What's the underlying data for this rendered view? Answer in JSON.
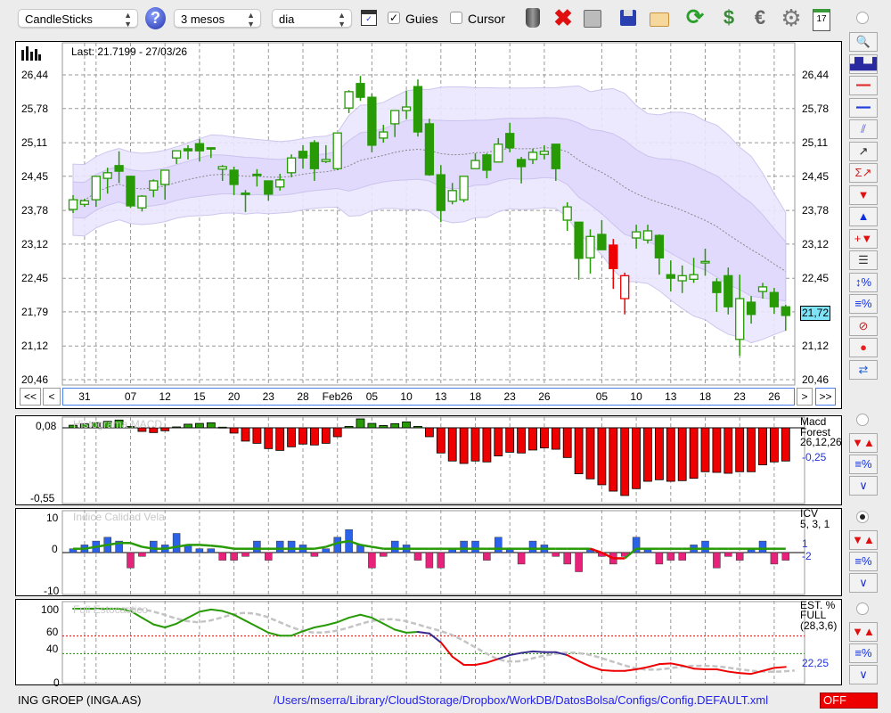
{
  "toolbar": {
    "chart_type": "CandleSticks",
    "period": "3 mesos",
    "interval": "dia",
    "guides_label": "Guies",
    "guides_checked": true,
    "cursor_label": "Cursor",
    "cursor_checked": false,
    "icons": [
      "help-icon",
      "chart-window-icon",
      "trash-icon",
      "delete-icon",
      "print-icon",
      "save-icon",
      "folder-icon",
      "refresh-icon",
      "money-icon",
      "euro-icon",
      "gear-icon",
      "calendar-icon"
    ],
    "calendar_day": "17"
  },
  "main_chart": {
    "last_label": "Last: 21.7199 - 27/03/26",
    "last_value": "21,72",
    "price_ticks": [
      "26,44",
      "25,78",
      "25,11",
      "24,45",
      "23,78",
      "23,12",
      "22,45",
      "21,79",
      "21,12",
      "20,46"
    ],
    "price_tick_values": [
      26.44,
      25.78,
      25.11,
      24.45,
      23.78,
      23.12,
      22.45,
      21.79,
      21.12,
      20.46
    ],
    "colors": {
      "candle": "#279a05",
      "candle_alert": "#ee0000",
      "band_outer": "#ebe6fd",
      "band_inner": "#e0d9fc",
      "last_box": "#7fe3f7"
    }
  },
  "navigation": {
    "first": "<<",
    "prev": "<",
    "next": ">",
    "last": ">>",
    "date_labels": [
      {
        "label": "31",
        "index": 1
      },
      {
        "label": "07",
        "index": 5
      },
      {
        "label": "12",
        "index": 8
      },
      {
        "label": "15",
        "index": 11
      },
      {
        "label": "20",
        "index": 14
      },
      {
        "label": "23",
        "index": 17
      },
      {
        "label": "28",
        "index": 20
      },
      {
        "label": "Feb26",
        "index": 23
      },
      {
        "label": "05",
        "index": 26
      },
      {
        "label": "10",
        "index": 29
      },
      {
        "label": "13",
        "index": 32
      },
      {
        "label": "18",
        "index": 35
      },
      {
        "label": "23",
        "index": 38
      },
      {
        "label": "26",
        "index": 41
      },
      {
        "label": "05",
        "index": 46
      },
      {
        "label": "10",
        "index": 49
      },
      {
        "label": "13",
        "index": 52
      },
      {
        "label": "18",
        "index": 55
      },
      {
        "label": "23",
        "index": 58
      },
      {
        "label": "26",
        "index": 61
      }
    ],
    "extra_grid_index": [
      2
    ]
  },
  "chart_data": [
    {
      "type": "candlestick",
      "title": "CandleSticks",
      "ylim": [
        20.46,
        26.44
      ],
      "candles": [
        [
          23.8,
          24.08,
          23.73,
          23.99
        ],
        [
          23.9,
          24.01,
          23.85,
          23.97
        ],
        [
          23.99,
          24.46,
          23.85,
          24.45
        ],
        [
          24.41,
          24.62,
          24.11,
          24.52
        ],
        [
          24.66,
          24.94,
          24.32,
          24.55
        ],
        [
          24.45,
          24.46,
          23.83,
          23.87
        ],
        [
          23.83,
          24.08,
          23.76,
          24.06
        ],
        [
          24.18,
          24.39,
          24.04,
          24.36
        ],
        [
          24.29,
          24.57,
          23.99,
          24.57
        ],
        [
          24.81,
          24.95,
          24.69,
          24.95
        ],
        [
          24.99,
          25.06,
          24.78,
          24.95
        ],
        [
          25.09,
          25.18,
          24.74,
          24.95
        ],
        [
          25.01,
          25.01,
          24.81,
          25.0
        ],
        [
          24.59,
          24.67,
          24.36,
          24.64
        ],
        [
          24.57,
          24.64,
          24.08,
          24.29
        ],
        [
          24.12,
          24.18,
          23.75,
          24.1
        ],
        [
          24.49,
          24.59,
          24.25,
          24.48
        ],
        [
          24.36,
          24.36,
          23.97,
          24.1
        ],
        [
          24.24,
          24.5,
          24.17,
          24.38
        ],
        [
          24.52,
          24.88,
          24.43,
          24.81
        ],
        [
          24.94,
          25.06,
          24.6,
          24.81
        ],
        [
          25.11,
          25.16,
          24.36,
          24.6
        ],
        [
          24.74,
          25.06,
          24.71,
          24.78
        ],
        [
          24.6,
          25.3,
          24.57,
          25.3
        ],
        [
          25.79,
          26.14,
          25.69,
          26.11
        ],
        [
          26.27,
          26.42,
          25.93,
          26.0
        ],
        [
          26.0,
          26.07,
          24.92,
          25.06
        ],
        [
          25.2,
          25.46,
          25.11,
          25.32
        ],
        [
          25.48,
          25.74,
          25.22,
          25.74
        ],
        [
          25.74,
          26.13,
          25.57,
          25.81
        ],
        [
          26.21,
          26.35,
          25.23,
          25.32
        ],
        [
          25.48,
          25.58,
          24.46,
          24.48
        ],
        [
          24.48,
          24.67,
          23.55,
          23.78
        ],
        [
          23.96,
          24.32,
          23.9,
          24.17
        ],
        [
          23.99,
          24.45,
          23.94,
          24.45
        ],
        [
          24.6,
          24.9,
          24.6,
          24.76
        ],
        [
          24.87,
          24.9,
          24.41,
          24.57
        ],
        [
          24.73,
          25.2,
          24.73,
          25.08
        ],
        [
          25.29,
          25.5,
          24.92,
          25.01
        ],
        [
          24.78,
          24.83,
          24.31,
          24.64
        ],
        [
          24.78,
          24.99,
          24.69,
          24.92
        ],
        [
          24.88,
          25.06,
          24.78,
          24.94
        ],
        [
          25.08,
          25.08,
          24.36,
          24.6
        ],
        [
          23.59,
          23.94,
          23.38,
          23.85
        ],
        [
          23.55,
          23.55,
          22.42,
          22.84
        ],
        [
          22.85,
          23.41,
          22.54,
          23.27
        ],
        [
          23.31,
          23.59,
          23.01,
          23.01
        ],
        [
          23.1,
          23.22,
          22.24,
          22.64
        ],
        [
          22.05,
          22.56,
          21.74,
          22.5
        ],
        [
          23.24,
          23.5,
          23.03,
          23.36
        ],
        [
          23.2,
          23.5,
          23.13,
          23.38
        ],
        [
          23.29,
          23.31,
          22.52,
          22.85
        ],
        [
          22.52,
          22.8,
          22.19,
          22.45
        ],
        [
          22.4,
          22.7,
          22.16,
          22.5
        ],
        [
          22.43,
          22.85,
          22.36,
          22.52
        ],
        [
          22.75,
          23.03,
          22.5,
          22.78
        ],
        [
          22.38,
          22.45,
          21.79,
          22.17
        ],
        [
          22.5,
          22.66,
          21.74,
          21.89
        ],
        [
          21.25,
          22.52,
          20.93,
          22.05
        ],
        [
          21.98,
          22.1,
          21.56,
          21.74
        ],
        [
          22.19,
          22.36,
          22.05,
          22.28
        ],
        [
          22.17,
          22.26,
          21.75,
          21.89
        ],
        [
          21.89,
          21.93,
          21.42,
          21.72
        ]
      ],
      "alert_candles": [
        47,
        48
      ]
    },
    {
      "type": "bar",
      "title": "Histograma MACD",
      "name": "Macd",
      "subtitle": "Forest",
      "params": "26,12,26",
      "last_value": "-0,25",
      "ylim_labels": [
        "0,08",
        "-0,55"
      ],
      "ylim": [
        -0.55,
        0.08
      ],
      "colors": {
        "pos": "#279a05",
        "neg": "#ee0000"
      },
      "values": [
        0.02,
        0.03,
        0.04,
        0.05,
        0.06,
        0.01,
        -0.028,
        -0.037,
        -0.023,
        0.007,
        0.028,
        0.034,
        0.039,
        0.005,
        -0.041,
        -0.103,
        -0.12,
        -0.161,
        -0.175,
        -0.147,
        -0.126,
        -0.133,
        -0.12,
        -0.069,
        0.011,
        0.069,
        0.034,
        0.018,
        0.032,
        0.046,
        0.011,
        -0.069,
        -0.195,
        -0.257,
        -0.276,
        -0.257,
        -0.264,
        -0.218,
        -0.189,
        -0.195,
        -0.172,
        -0.156,
        -0.166,
        -0.23,
        -0.356,
        -0.395,
        -0.441,
        -0.49,
        -0.524,
        -0.471,
        -0.414,
        -0.402,
        -0.414,
        -0.409,
        -0.391,
        -0.34,
        -0.345,
        -0.352,
        -0.34,
        -0.34,
        -0.287,
        -0.264,
        -0.257
      ]
    },
    {
      "type": "bar",
      "title": "Indice Calidad Vela",
      "name": "ICV",
      "params": "5, 3, 1",
      "last_values": [
        "1",
        "-2"
      ],
      "ylim_labels": [
        "10",
        "0",
        "-10"
      ],
      "ylim": [
        -10,
        10
      ],
      "colors": {
        "pos": "#2a62ea",
        "neg": "#e8217b",
        "line": "#279a05",
        "line_alert": "#ee0000"
      },
      "values": [
        1,
        2,
        3,
        4,
        3,
        -4,
        -1,
        3,
        2,
        5,
        2,
        1,
        1,
        -2,
        -2,
        -1,
        3,
        -2,
        3,
        3,
        2,
        -1,
        1,
        4,
        6,
        2,
        -4,
        -1,
        3,
        2,
        -2,
        -4,
        -4,
        1,
        3,
        3,
        -2,
        4,
        1,
        -3,
        3,
        2,
        -1,
        -3,
        -5,
        1,
        -1,
        -3,
        -1,
        4,
        1,
        -3,
        -2,
        -2,
        2,
        3,
        -4,
        -1,
        -2,
        1,
        3,
        -3,
        -2
      ],
      "signal": [
        1,
        1,
        1.5,
        2,
        2.5,
        2.5,
        1.5,
        1,
        1,
        1.5,
        2,
        2,
        1.8,
        1.5,
        1,
        1,
        1,
        1,
        1,
        1,
        1,
        1,
        1.5,
        2.5,
        3,
        2,
        1.5,
        1,
        1,
        1,
        1,
        1,
        1,
        1,
        1,
        1,
        1,
        1,
        1,
        1,
        1,
        1,
        1,
        1,
        1,
        1,
        0,
        -1.5,
        -1.5,
        1,
        1,
        1,
        1,
        1,
        1,
        1,
        1,
        1,
        1,
        1,
        1,
        1,
        1
      ],
      "signal_alert_from": 45,
      "signal_alert_to": 48
    },
    {
      "type": "line",
      "title": "Full Estocastico",
      "name": "EST. %",
      "subtitle": "FULL",
      "params": "(28,3,6)",
      "last_value": "22,25",
      "ylim_labels": [
        "100",
        "60",
        "40",
        "0"
      ],
      "ylim": [
        0,
        100
      ],
      "levels": [
        60,
        40
      ],
      "colors": {
        "g": "#279a05",
        "p": "#3a2a90",
        "r": "#ee0000",
        "signal": "#c4c4c4",
        "level60": "#dd0000",
        "level40": "#1a8a00"
      },
      "k": [
        100,
        100,
        100,
        100,
        100,
        97,
        88,
        79,
        75,
        80,
        88,
        96,
        99,
        97,
        92,
        84,
        76,
        68,
        64,
        64,
        70,
        75,
        78,
        82,
        88,
        92,
        88,
        80,
        72,
        68,
        69,
        67,
        55,
        36,
        25,
        25,
        28,
        33,
        38,
        41,
        43,
        42,
        42,
        38,
        30,
        23,
        18,
        17,
        17,
        19,
        22,
        26,
        27,
        24,
        20,
        19,
        19,
        16,
        14,
        13,
        17,
        21,
        22.25
      ],
      "k_colors": "gggggggggggggggggggggggggggggggpprrrrrpppppprrrrrrrrrrrrrrrrrrr"
    }
  ],
  "right_panel": {
    "main_buttons": [
      "zoom-icon",
      "volume-chart-icon",
      "red-line-icon",
      "blue-line-icon",
      "channel-icon",
      "trendline-icon",
      "sum-trendline-icon",
      "sell-arrow-icon",
      "buy-arrow-icon",
      "add-signal-icon",
      "grid-lines-icon",
      "percent-range-icon",
      "percent-lines-icon",
      "stop-icon",
      "record-icon",
      "sync-icon"
    ],
    "sub_buttons": [
      "signals-icon",
      "percent-lines-icon",
      "curve-icon"
    ]
  },
  "status": {
    "security": "ING GROEP (INGA.AS)",
    "config_path": "/Users/mserra/Library/CloudStorage/Dropbox/WorkDB/DatosBolsa/Configs/Config.DEFAULT.xml",
    "mode": "OFF"
  }
}
